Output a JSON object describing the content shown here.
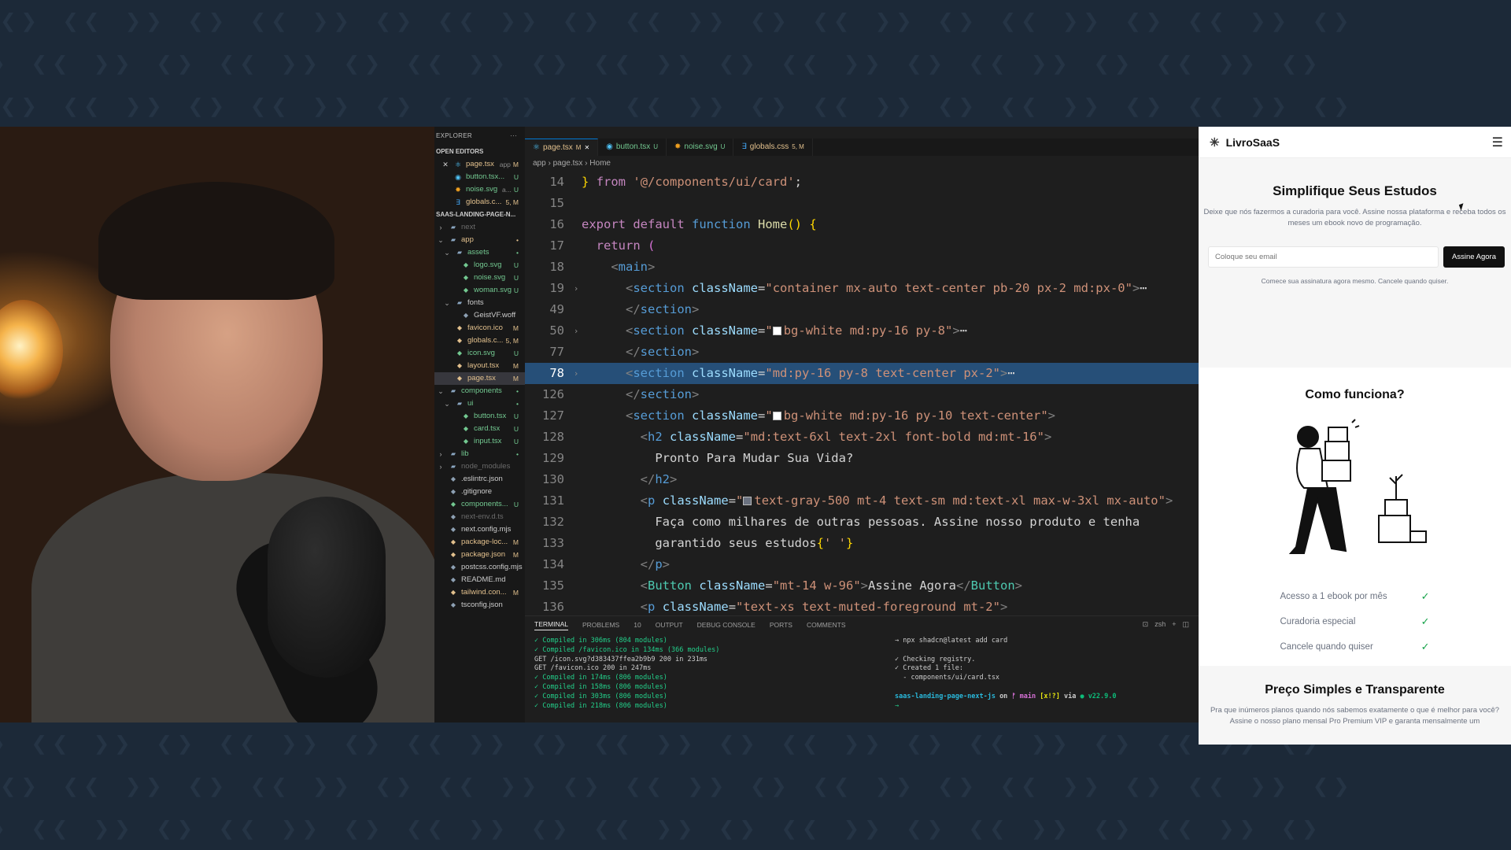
{
  "explorer": {
    "title": "EXPLORER",
    "open_editors_label": "OPEN EDITORS",
    "open_editors": [
      {
        "name": "page.tsx",
        "extra": "app",
        "badge": "M",
        "icon": "react-icon",
        "color": "#e2c08d",
        "close": "✕"
      },
      {
        "name": "button.tsx...",
        "badge": "U",
        "icon": "typescript-icon",
        "color": "#73c991"
      },
      {
        "name": "noise.svg",
        "extra": "a...",
        "badge": "U",
        "icon": "svg-icon",
        "color": "#73c991"
      },
      {
        "name": "globals.c...",
        "badge": "5, M",
        "icon": "css-icon",
        "color": "#e2c08d"
      }
    ],
    "project_label": "SAAS-LANDING-PAGE-N...",
    "tree": [
      {
        "name": "next",
        "depth": 0,
        "kind": "folder",
        "open": false,
        "dim": true
      },
      {
        "name": "app",
        "depth": 0,
        "kind": "folder",
        "open": true,
        "badge": "•",
        "color": "#e2c08d"
      },
      {
        "name": "assets",
        "depth": 1,
        "kind": "folder",
        "open": true,
        "badge": "•",
        "color": "#73c991"
      },
      {
        "name": "logo.svg",
        "depth": 2,
        "kind": "file",
        "badge": "U",
        "color": "#73c991"
      },
      {
        "name": "noise.svg",
        "depth": 2,
        "kind": "file",
        "badge": "U",
        "color": "#73c991"
      },
      {
        "name": "woman.svg",
        "depth": 2,
        "kind": "file",
        "badge": "U",
        "color": "#73c991"
      },
      {
        "name": "fonts",
        "depth": 1,
        "kind": "folder",
        "open": true
      },
      {
        "name": "GeistVF.woff",
        "depth": 2,
        "kind": "file"
      },
      {
        "name": "favicon.ico",
        "depth": 1,
        "kind": "file",
        "badge": "M",
        "color": "#e2c08d"
      },
      {
        "name": "globals.c...",
        "depth": 1,
        "kind": "file",
        "badge": "5, M",
        "color": "#e2c08d"
      },
      {
        "name": "icon.svg",
        "depth": 1,
        "kind": "file",
        "badge": "U",
        "color": "#73c991"
      },
      {
        "name": "layout.tsx",
        "depth": 1,
        "kind": "file",
        "badge": "M",
        "color": "#e2c08d"
      },
      {
        "name": "page.tsx",
        "depth": 1,
        "kind": "file",
        "badge": "M",
        "color": "#e2c08d",
        "selected": true
      },
      {
        "name": "components",
        "depth": 0,
        "kind": "folder",
        "open": true,
        "badge": "•",
        "color": "#73c991"
      },
      {
        "name": "ui",
        "depth": 1,
        "kind": "folder",
        "open": true,
        "badge": "•",
        "color": "#73c991"
      },
      {
        "name": "button.tsx",
        "depth": 2,
        "kind": "file",
        "badge": "U",
        "color": "#73c991"
      },
      {
        "name": "card.tsx",
        "depth": 2,
        "kind": "file",
        "badge": "U",
        "color": "#73c991"
      },
      {
        "name": "input.tsx",
        "depth": 2,
        "kind": "file",
        "badge": "U",
        "color": "#73c991"
      },
      {
        "name": "lib",
        "depth": 0,
        "kind": "folder",
        "open": false,
        "badge": "•",
        "color": "#73c991"
      },
      {
        "name": "node_modules",
        "depth": 0,
        "kind": "folder",
        "open": false,
        "dim": true
      },
      {
        "name": ".eslintrc.json",
        "depth": 0,
        "kind": "file"
      },
      {
        "name": ".gitignore",
        "depth": 0,
        "kind": "file"
      },
      {
        "name": "components...",
        "depth": 0,
        "kind": "file",
        "badge": "U",
        "color": "#73c991"
      },
      {
        "name": "next-env.d.ts",
        "depth": 0,
        "kind": "file",
        "dim": true
      },
      {
        "name": "next.config.mjs",
        "depth": 0,
        "kind": "file"
      },
      {
        "name": "package-loc...",
        "depth": 0,
        "kind": "file",
        "badge": "M",
        "color": "#e2c08d"
      },
      {
        "name": "package.json",
        "depth": 0,
        "kind": "file",
        "badge": "M",
        "color": "#e2c08d"
      },
      {
        "name": "postcss.config.mjs",
        "depth": 0,
        "kind": "file"
      },
      {
        "name": "README.md",
        "depth": 0,
        "kind": "file"
      },
      {
        "name": "tailwind.con...",
        "depth": 0,
        "kind": "file",
        "badge": "M",
        "color": "#e2c08d"
      },
      {
        "name": "tsconfig.json",
        "depth": 0,
        "kind": "file"
      }
    ]
  },
  "tabs": [
    {
      "label": "page.tsx",
      "status": "M",
      "active": true,
      "close": "✕",
      "icon": "react-icon"
    },
    {
      "label": "button.tsx",
      "status": "U",
      "icon": "typescript-icon"
    },
    {
      "label": "noise.svg",
      "status": "U",
      "icon": "svg-icon"
    },
    {
      "label": "globals.css",
      "status": "5, M",
      "icon": "css-icon"
    }
  ],
  "breadcrumb": [
    "app",
    "page.tsx",
    "Home"
  ],
  "code_lines": [
    {
      "n": "14",
      "t": [
        [
          "br",
          "}"
        ],
        [
          "txt",
          " "
        ],
        [
          "kw",
          "from"
        ],
        [
          "txt",
          " "
        ],
        [
          "str",
          "'@/components/ui/card'"
        ],
        [
          "txt",
          ";"
        ]
      ]
    },
    {
      "n": "15",
      "t": []
    },
    {
      "n": "16",
      "t": [
        [
          "kw",
          "export"
        ],
        [
          "txt",
          " "
        ],
        [
          "kw",
          "default"
        ],
        [
          "txt",
          " "
        ],
        [
          "kb",
          "function"
        ],
        [
          "txt",
          " "
        ],
        [
          "fn",
          "Home"
        ],
        [
          "br",
          "()"
        ],
        [
          "txt",
          " "
        ],
        [
          "br",
          "{"
        ]
      ]
    },
    {
      "n": "17",
      "t": [
        [
          "txt",
          "  "
        ],
        [
          "kw",
          "return"
        ],
        [
          "txt",
          " "
        ],
        [
          "mg",
          "("
        ]
      ]
    },
    {
      "n": "18",
      "t": [
        [
          "txt",
          "    "
        ],
        [
          "pn",
          "<"
        ],
        [
          "tg",
          "main"
        ],
        [
          "pn",
          ">"
        ]
      ]
    },
    {
      "n": "19",
      "fold": "›",
      "t": [
        [
          "txt",
          "      "
        ],
        [
          "pn",
          "<"
        ],
        [
          "tg",
          "section"
        ],
        [
          "txt",
          " "
        ],
        [
          "at",
          "className"
        ],
        [
          "txt",
          "="
        ],
        [
          "str",
          "\"container mx-auto text-center pb-20 px-2 md:px-0\""
        ],
        [
          "pn",
          ">"
        ],
        [
          "txt",
          "⋯"
        ]
      ]
    },
    {
      "n": "49",
      "t": [
        [
          "txt",
          "      "
        ],
        [
          "pn",
          "</"
        ],
        [
          "tg",
          "section"
        ],
        [
          "pn",
          ">"
        ]
      ]
    },
    {
      "n": "50",
      "fold": "›",
      "t": [
        [
          "txt",
          "      "
        ],
        [
          "pn",
          "<"
        ],
        [
          "tg",
          "section"
        ],
        [
          "txt",
          " "
        ],
        [
          "at",
          "className"
        ],
        [
          "txt",
          "="
        ],
        [
          "str",
          "\""
        ],
        [
          "sw",
          "#ffffff"
        ],
        [
          "str",
          "bg-white md:py-16 py-8\""
        ],
        [
          "pn",
          ">"
        ],
        [
          "txt",
          "⋯"
        ]
      ]
    },
    {
      "n": "77",
      "t": [
        [
          "txt",
          "      "
        ],
        [
          "pn",
          "</"
        ],
        [
          "tg",
          "section"
        ],
        [
          "pn",
          ">"
        ]
      ]
    },
    {
      "n": "78",
      "fold": "›",
      "hl": true,
      "t": [
        [
          "txt",
          "      "
        ],
        [
          "pn",
          "<"
        ],
        [
          "tg",
          "section"
        ],
        [
          "txt",
          " "
        ],
        [
          "at",
          "className"
        ],
        [
          "txt",
          "="
        ],
        [
          "str",
          "\"md:py-16 py-8 text-center px-2\""
        ],
        [
          "pn",
          ">"
        ],
        [
          "txt",
          "⋯"
        ]
      ]
    },
    {
      "n": "126",
      "t": [
        [
          "txt",
          "      "
        ],
        [
          "pn",
          "</"
        ],
        [
          "tg",
          "section"
        ],
        [
          "pn",
          ">"
        ]
      ]
    },
    {
      "n": "127",
      "t": [
        [
          "txt",
          "      "
        ],
        [
          "pn",
          "<"
        ],
        [
          "tg",
          "section"
        ],
        [
          "txt",
          " "
        ],
        [
          "at",
          "className"
        ],
        [
          "txt",
          "="
        ],
        [
          "str",
          "\""
        ],
        [
          "sw",
          "#ffffff"
        ],
        [
          "str",
          "bg-white md:py-16 py-10 text-center\""
        ],
        [
          "pn",
          ">"
        ]
      ]
    },
    {
      "n": "128",
      "t": [
        [
          "txt",
          "        "
        ],
        [
          "pn",
          "<"
        ],
        [
          "tg",
          "h2"
        ],
        [
          "txt",
          " "
        ],
        [
          "at",
          "className"
        ],
        [
          "txt",
          "="
        ],
        [
          "str",
          "\"md:text-6xl text-2xl font-bold md:mt-16\""
        ],
        [
          "pn",
          ">"
        ]
      ]
    },
    {
      "n": "129",
      "t": [
        [
          "txt",
          "          Pronto Para Mudar Sua Vida?"
        ]
      ]
    },
    {
      "n": "130",
      "t": [
        [
          "txt",
          "        "
        ],
        [
          "pn",
          "</"
        ],
        [
          "tg",
          "h2"
        ],
        [
          "pn",
          ">"
        ]
      ]
    },
    {
      "n": "131",
      "t": [
        [
          "txt",
          "        "
        ],
        [
          "pn",
          "<"
        ],
        [
          "tg",
          "p"
        ],
        [
          "txt",
          " "
        ],
        [
          "at",
          "className"
        ],
        [
          "txt",
          "="
        ],
        [
          "str",
          "\""
        ],
        [
          "sw",
          "#6b7280"
        ],
        [
          "str",
          "text-gray-500 mt-4 text-sm md:text-xl max-w-3xl mx-auto\""
        ],
        [
          "pn",
          ">"
        ]
      ]
    },
    {
      "n": "132",
      "t": [
        [
          "txt",
          "          Faça como milhares de outras pessoas. Assine nosso produto e tenha"
        ]
      ]
    },
    {
      "n": "133",
      "t": [
        [
          "txt",
          "          garantido seus estudos"
        ],
        [
          "br",
          "{"
        ],
        [
          "str",
          "' '"
        ],
        [
          "br",
          "}"
        ]
      ]
    },
    {
      "n": "134",
      "t": [
        [
          "txt",
          "        "
        ],
        [
          "pn",
          "</"
        ],
        [
          "tg",
          "p"
        ],
        [
          "pn",
          ">"
        ]
      ]
    },
    {
      "n": "135",
      "t": [
        [
          "txt",
          "        "
        ],
        [
          "pn",
          "<"
        ],
        [
          "cmp",
          "Button"
        ],
        [
          "txt",
          " "
        ],
        [
          "at",
          "className"
        ],
        [
          "txt",
          "="
        ],
        [
          "str",
          "\"mt-14 w-96\""
        ],
        [
          "pn",
          ">"
        ],
        [
          "txt",
          "Assine Agora"
        ],
        [
          "pn",
          "</"
        ],
        [
          "cmp",
          "Button"
        ],
        [
          "pn",
          ">"
        ]
      ]
    },
    {
      "n": "136",
      "t": [
        [
          "txt",
          "        "
        ],
        [
          "pn",
          "<"
        ],
        [
          "tg",
          "p"
        ],
        [
          "txt",
          " "
        ],
        [
          "at",
          "className"
        ],
        [
          "txt",
          "="
        ],
        [
          "str",
          "\"text-xs text-muted-foreground mt-2\""
        ],
        [
          "pn",
          ">"
        ]
      ]
    }
  ],
  "panel": {
    "tabs": [
      "TERMINAL",
      "PROBLEMS",
      "10",
      "OUTPUT",
      "DEBUG CONSOLE",
      "PORTS",
      "COMMENTS"
    ],
    "shell": "zsh",
    "left_lines": [
      "✓ Compiled in 306ms (804 modules)",
      "✓ Compiled /favicon.ico in 134ms (366 modules)",
      "GET /icon.svg?d383437ffea2b9b9 200 in 231ms",
      "GET /favicon.ico 200 in 247ms",
      "✓ Compiled in 174ms (806 modules)",
      "✓ Compiled in 158ms (806 modules)",
      "✓ Compiled in 303ms (806 modules)",
      "✓ Compiled in 218ms (806 modules)"
    ],
    "right_cmd": "→ npx shadcn@latest add card",
    "right_lines": [
      "✓ Checking registry.",
      "✓ Created 1 file:",
      "  - components/ui/card.tsx"
    ],
    "prompt": {
      "dir": "saas-landing-page-next-js",
      "on": "on",
      "branch": "ᚠ main",
      "state": "[x!?]",
      "via": "via",
      "node": "● v22.9.0"
    },
    "prompt_arrow": "→"
  },
  "site": {
    "brand": "LivroSaaS",
    "hero_title": "Simplifique Seus Estudos",
    "hero_text": "Deixe que nós fazermos a curadoria para você. Assine nossa plataforma e receba todos os meses um ebook novo de programação.",
    "email_placeholder": "Coloque seu email",
    "cta": "Assine Agora",
    "note": "Comece sua assinatura agora mesmo. Cancele quando quiser.",
    "how_title": "Como funciona?",
    "features": [
      "Acesso a 1 ebook por mês",
      "Curadoria especial",
      "Cancele quando quiser"
    ],
    "price_title": "Preço Simples e Transparente",
    "price_text": "Pra que inúmeros planos quando nós sabemos exatamente o que é melhor para você? Assine o nosso plano mensal Pro Premium VIP e garanta mensalmente um"
  }
}
